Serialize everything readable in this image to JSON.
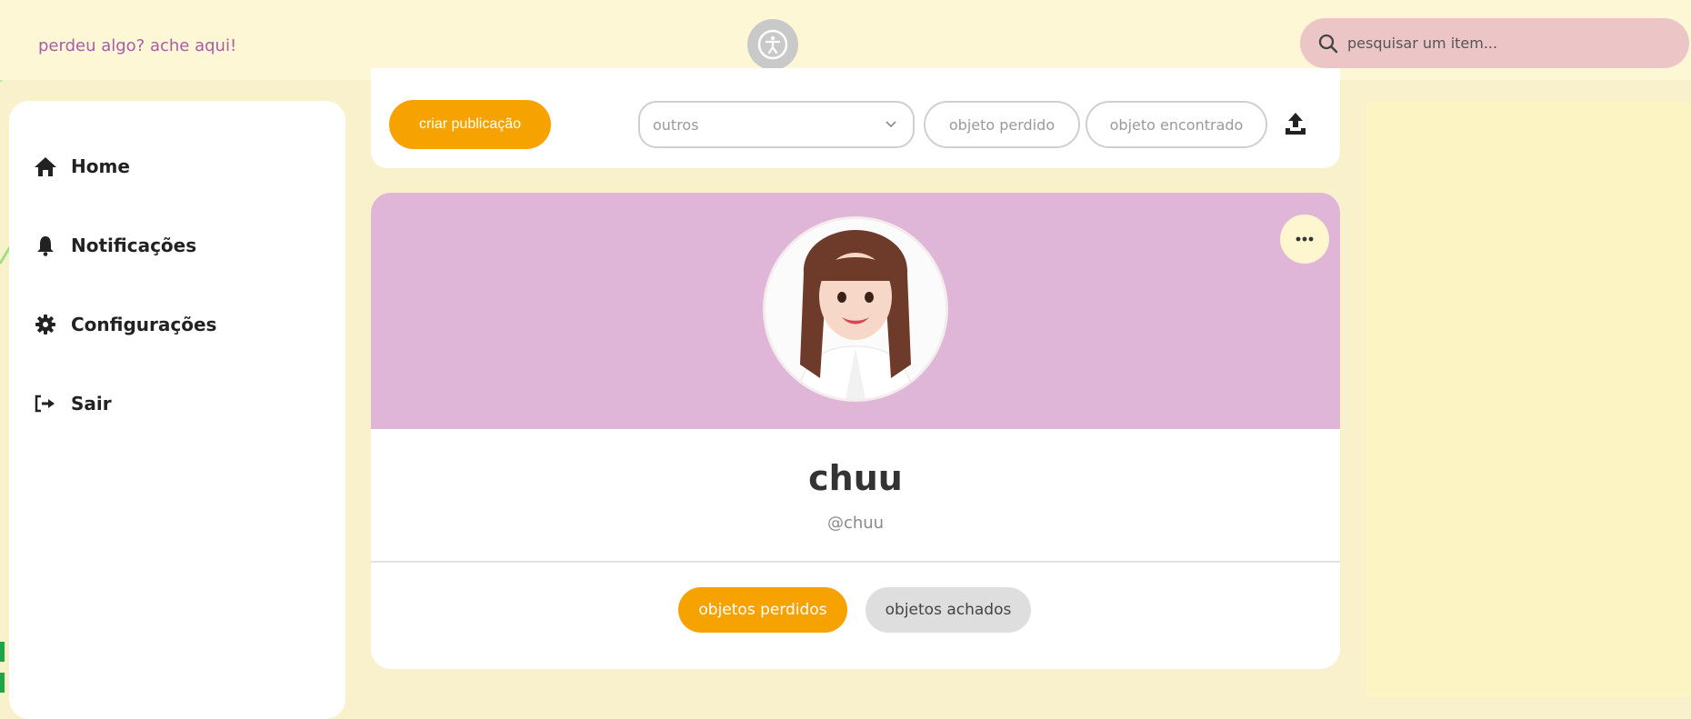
{
  "header": {
    "tagline": "perdeu algo? ache aqui!",
    "accessibility_icon": "accessibility-icon",
    "search": {
      "placeholder": "pesquisar um item...",
      "icon": "search-icon"
    }
  },
  "sidebar": {
    "items": [
      {
        "label": "Home",
        "icon": "home-icon"
      },
      {
        "label": "Notificações",
        "icon": "bell-icon"
      },
      {
        "label": "Configurações",
        "icon": "gear-icon"
      },
      {
        "label": "Sair",
        "icon": "logout-icon"
      }
    ]
  },
  "toolbar": {
    "create_label": "criar publicação",
    "category": {
      "selected": "outros"
    },
    "lost_label": "objeto perdido",
    "found_label": "objeto encontrado",
    "upload_icon": "upload-icon"
  },
  "profile": {
    "name": "chuu",
    "handle": "@chuu",
    "more_icon": "more-horizontal-icon",
    "tabs": [
      {
        "label": "objetos perdidos",
        "active": true
      },
      {
        "label": "objetos achados",
        "active": false
      }
    ]
  },
  "colors": {
    "accent": "#f6a200",
    "banner": "#dfb5d8",
    "background": "#f9f0cc",
    "tagline": "#a65ea6",
    "search_bg": "#ecc6c6"
  }
}
